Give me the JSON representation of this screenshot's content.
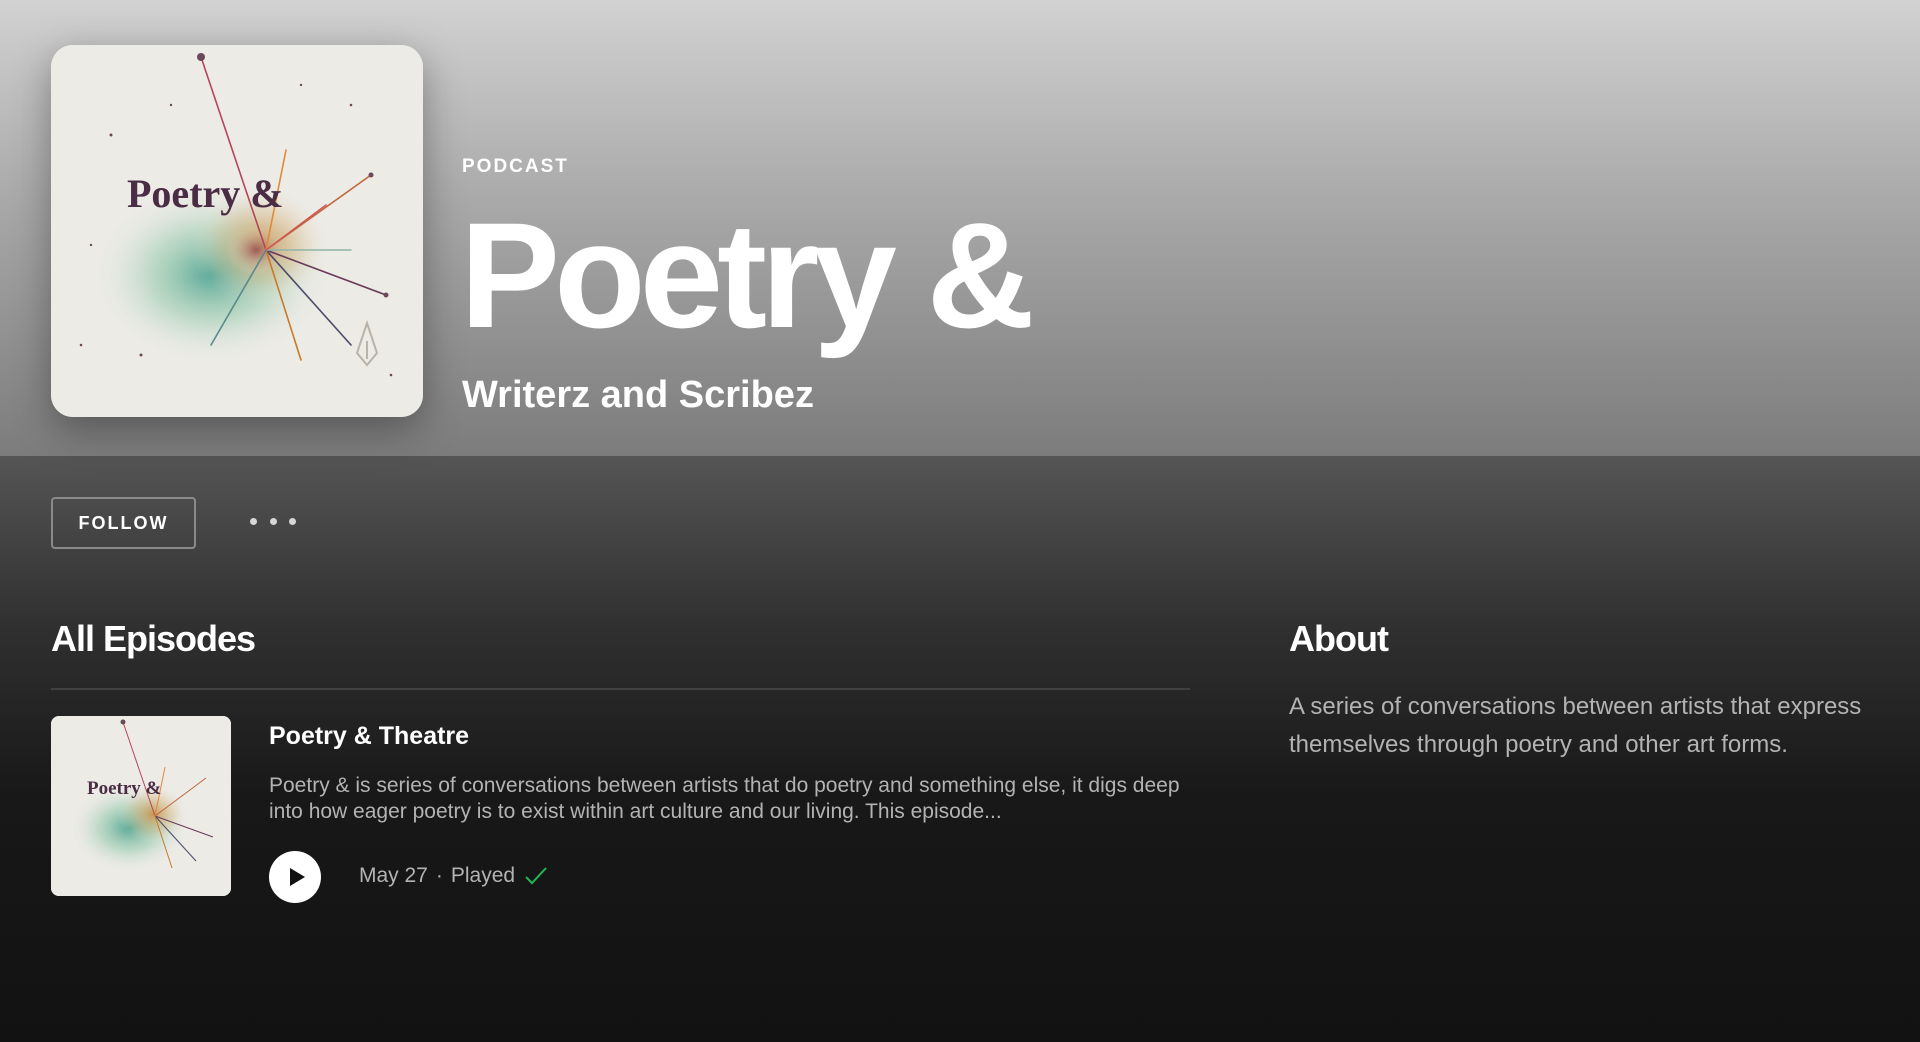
{
  "header": {
    "type_label": "PODCAST",
    "title": "Poetry &",
    "publisher": "Writerz and Scribez",
    "cover_text": "Poetry &",
    "cover_icon": "fountain-pen-icon"
  },
  "actions": {
    "follow_label": "FOLLOW",
    "more_icon": "more-options-icon"
  },
  "episodes": {
    "section_title": "All Episodes",
    "items": [
      {
        "thumb_text": "Poetry &",
        "title": "Poetry & Theatre",
        "description": "Poetry & is series of conversations between artists that do poetry and something else, it digs deep into how eager poetry is to exist within art culture and our living. This episode...",
        "date": "May 27",
        "separator": "·",
        "status": "Played",
        "play_icon": "play-icon",
        "status_icon": "check-icon"
      }
    ]
  },
  "about": {
    "section_title": "About",
    "text": "A series of conversations between artists that express themselves through poetry and other art forms."
  },
  "colors": {
    "background": "#121212",
    "header_top": "#d2d2d2",
    "header_bottom": "#7c7c7c",
    "secondary_text": "#b3b3b3",
    "played_check": "#1db954",
    "cover_text": "#4a2c45"
  }
}
